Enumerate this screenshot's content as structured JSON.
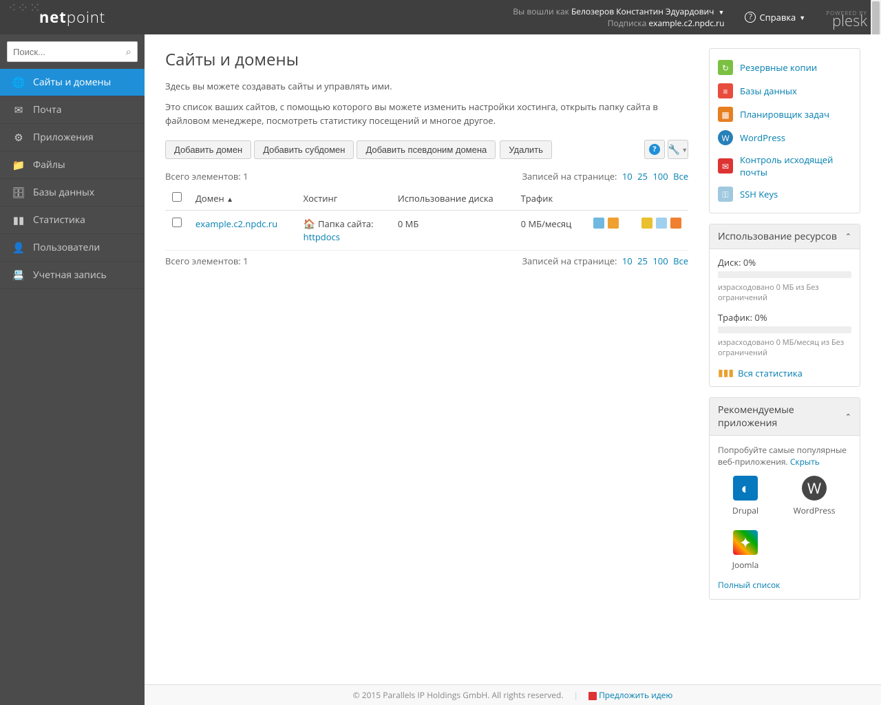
{
  "header": {
    "logged_in_as_label": "Вы вошли как",
    "user_name": "Белозеров Константин Эдуардович",
    "subscription_label": "Подписка",
    "subscription_value": "example.c2.npdc.ru",
    "help_label": "Справка",
    "powered_by": "POWERED BY",
    "brand": "plesk",
    "logo": "netpoint"
  },
  "search": {
    "placeholder": "Поиск..."
  },
  "sidebar": {
    "items": [
      {
        "label": "Сайты и домены",
        "icon": "globe",
        "active": true
      },
      {
        "label": "Почта",
        "icon": "mail"
      },
      {
        "label": "Приложения",
        "icon": "gear"
      },
      {
        "label": "Файлы",
        "icon": "folder"
      },
      {
        "label": "Базы данных",
        "icon": "db"
      },
      {
        "label": "Статистика",
        "icon": "chart"
      },
      {
        "label": "Пользователи",
        "icon": "user"
      },
      {
        "label": "Учетная запись",
        "icon": "card"
      }
    ]
  },
  "page": {
    "title": "Сайты и домены",
    "intro1": "Здесь вы можете создавать сайты и управлять ими.",
    "intro2": "Это список ваших сайтов, с помощью которого вы можете изменить настройки хостинга, открыть папку сайта в файловом менеджере, посмотреть статистику посещений и многое другое."
  },
  "toolbar": {
    "add_domain": "Добавить домен",
    "add_subdomain": "Добавить субдомен",
    "add_alias": "Добавить псевдоним домена",
    "delete": "Удалить"
  },
  "list": {
    "total_label": "Всего элементов:",
    "total_count": "1",
    "perpage_label": "Записей на странице:",
    "perpage_opts": [
      "10",
      "25",
      "100",
      "Все"
    ],
    "cols": {
      "domain": "Домен",
      "hosting": "Хостинг",
      "disk": "Использование диска",
      "traffic": "Трафик"
    },
    "rows": [
      {
        "domain": "example.c2.npdc.ru",
        "hosting_label": "Папка сайта:",
        "hosting_path": "httpdocs",
        "disk": "0 МБ",
        "traffic": "0 МБ/месяц"
      }
    ]
  },
  "tools": {
    "items": [
      {
        "label": "Резервные копии",
        "color": "ti-green",
        "glyph": "↻"
      },
      {
        "label": "Базы данных",
        "color": "ti-db",
        "glyph": "≡"
      },
      {
        "label": "Планировщик задач",
        "color": "ti-cal",
        "glyph": "▦"
      },
      {
        "label": "WordPress",
        "color": "ti-wp",
        "glyph": "W"
      },
      {
        "label": "Контроль исходящей почты",
        "color": "ti-mail",
        "glyph": "✉"
      },
      {
        "label": "SSH Keys",
        "color": "ti-key",
        "glyph": "⚿"
      }
    ]
  },
  "resources": {
    "title": "Использование ресурсов",
    "disk_label": "Диск: 0%",
    "disk_text": "израсходовано 0 МБ из Без ограничений",
    "traffic_label": "Трафик: 0%",
    "traffic_text": "израсходовано 0 МБ/месяц из Без ограничений",
    "all_stats": "Вся статистика"
  },
  "apps": {
    "title": "Рекомендуемые приложения",
    "intro": "Попробуйте самые популярные веб-приложения.",
    "hide": "Скрыть",
    "list": [
      {
        "name": "Drupal",
        "cls": "ai-drupal",
        "glyph": "◐"
      },
      {
        "name": "WordPress",
        "cls": "ai-wp",
        "glyph": "W"
      },
      {
        "name": "Joomla",
        "cls": "ai-joomla",
        "glyph": "✦"
      }
    ],
    "full_list": "Полный список"
  },
  "footer": {
    "copyright": "© 2015 Parallels IP Holdings GmbH. All rights reserved.",
    "suggest": "Предложить идею"
  }
}
